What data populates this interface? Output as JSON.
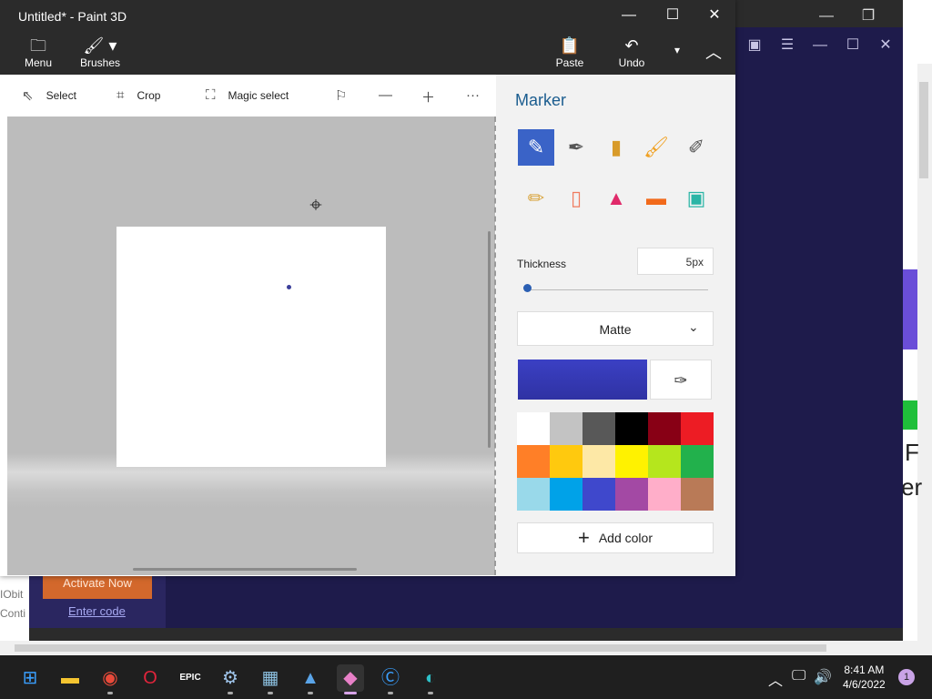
{
  "app": {
    "title": "Untitled* - Paint 3D"
  },
  "ribbon": {
    "menu_label": "Menu",
    "brushes_label": "Brushes",
    "paste_label": "Paste",
    "undo_label": "Undo"
  },
  "toolbar": {
    "select_label": "Select",
    "crop_label": "Crop",
    "magic_select_label": "Magic select"
  },
  "panel": {
    "title": "Marker",
    "thickness_label": "Thickness",
    "thickness_value": "5px",
    "thickness_level": 0.0,
    "finish_value": "Matte",
    "current_color": "#3b40c4",
    "add_color_label": "Add color",
    "brushes": [
      "marker",
      "calligraphy-pen",
      "oil-brush",
      "watercolor",
      "pixel-pen",
      "pencil",
      "eraser",
      "crayon",
      "spray-can",
      "fill-bucket"
    ],
    "palette": [
      "#ffffff",
      "#c3c3c3",
      "#585858",
      "#000000",
      "#880015",
      "#ed1c24",
      "#ff7f27",
      "#ffc90e",
      "#fde8a6",
      "#fff200",
      "#b5e61d",
      "#22b14c",
      "#99d9ea",
      "#00a2e8",
      "#3f48cc",
      "#a349a4",
      "#ffaec9",
      "#b97a57"
    ]
  },
  "background": {
    "activate_label": "Activate Now",
    "enter_code_label": "Enter code",
    "iobit_line1": "IObit",
    "iobit_line2": "Conti"
  },
  "taskbar": {
    "time": "8:41 AM",
    "date": "4/6/2022",
    "notification_count": "1"
  }
}
